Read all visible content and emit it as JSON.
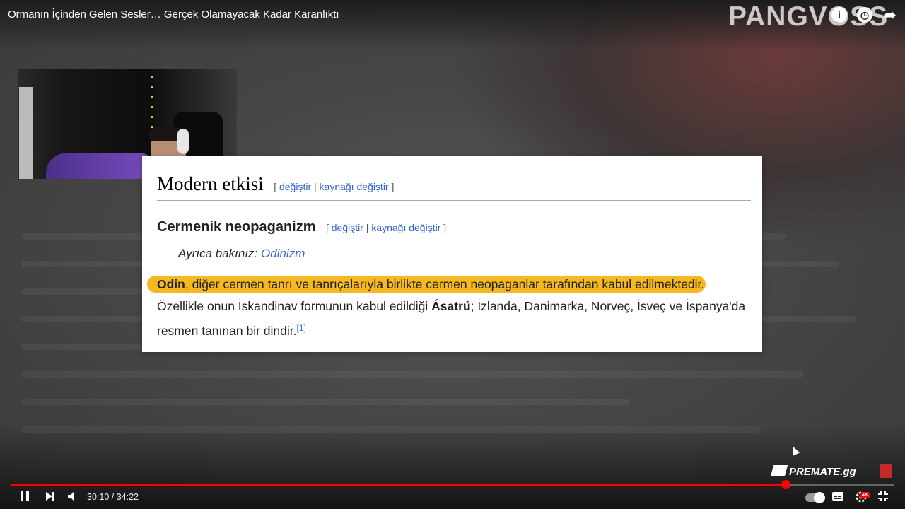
{
  "video": {
    "title": "Ormanın İçinden Gelen Sesler… Gerçek Olamayacak Kadar Karanlıktı",
    "channel_watermark": "PANGVOSS"
  },
  "top_icons": [
    {
      "name": "info-icon",
      "glyph": "i"
    },
    {
      "name": "watch-later-icon",
      "glyph": "◷"
    },
    {
      "name": "share-icon",
      "glyph": "➦"
    }
  ],
  "wiki": {
    "heading": "Modern etkisi",
    "heading_edit": {
      "open": "[",
      "edit": "değiştir",
      "sep": "|",
      "edit_source": "kaynağı değiştir",
      "close": "]"
    },
    "subheading": "Cermenik neopaganizm",
    "subheading_edit": {
      "open": "[",
      "edit": "değiştir",
      "sep": "|",
      "edit_source": "kaynağı değiştir",
      "close": "]"
    },
    "see_also_label": "Ayrıca bakınız:",
    "see_also_link": "Odinizm",
    "para_bold1": "Odin",
    "para_part1": ", diğer cermen tanrı ve tanrıçalarıyla birlikte cermen neopaganlar tarafından kabul edilmektedir.",
    "para_part2": "Özellikle onun İskandinav formunun kabul edildiği ",
    "para_bold2": "Ásatrú",
    "para_part3": "; İzlanda, Danimarka, Norveç, İsveç ve İspanya'da resmen tanınan bir dindir.",
    "reference": "[1]",
    "highlight_color": "#f5b820"
  },
  "branding": {
    "sponsor": "PREMATE.gg"
  },
  "player": {
    "current_time": "30:10",
    "duration": "34:22",
    "time_display": "30:10 / 34:22",
    "progress_fraction": 0.877,
    "accent_color": "#ff0000",
    "quality_badge": "4K",
    "controls": {
      "play_pause": "pause-icon",
      "next": "next-icon",
      "volume": "volume-icon",
      "autoplay": "autoplay-toggle",
      "subtitles": "subtitles-icon",
      "settings": "settings-icon",
      "fullscreen": "exit-fullscreen-icon"
    }
  }
}
